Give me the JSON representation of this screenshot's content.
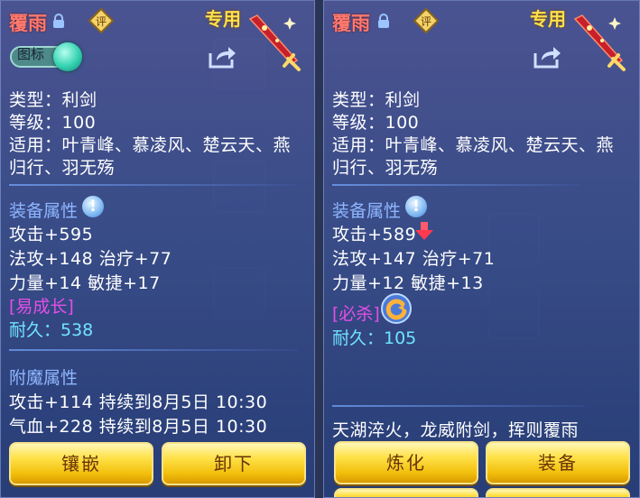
{
  "left": {
    "name": "覆雨",
    "exclusive": "专用",
    "toggle_label": "图标",
    "type": "类型：利剑",
    "level": "等级：100",
    "usable": "适用：叶青峰、慕凌风、楚云天、燕",
    "usable_cont": "归行、羽无殇",
    "attr_title": "装备属性",
    "attack": "攻击+595",
    "line2": "法攻+148  治疗+77",
    "line3": "力量+14  敏捷+17",
    "tag": "[易成长]",
    "durability": "耐久：538",
    "enchant_title": "附魔属性",
    "enchant1": "攻击+114  持续到8月5日 10:30",
    "enchant2": "气血+228  持续到8月5日 10:30",
    "btn1": "镶嵌",
    "btn2": "卸下"
  },
  "right": {
    "name": "覆雨",
    "exclusive": "专用",
    "type": "类型：利剑",
    "level": "等级：100",
    "usable": "适用：叶青峰、慕凌风、楚云天、燕",
    "usable_cont": "归行、羽无殇",
    "attr_title": "装备属性",
    "attack": "攻击+589",
    "line2": "法攻+147  治疗+71",
    "line3": "力量+12  敏捷+13",
    "tag": "[必杀]",
    "durability": "耐久：105",
    "flavor": "天湖淬火，龙威附剑，挥则覆雨",
    "btn1": "炼化",
    "btn2": "装备"
  },
  "icons": {
    "lock": "lock-icon",
    "rate": "rate-icon",
    "sword": "sword-icon",
    "share": "share-icon",
    "info": "info-icon",
    "arrow_down": "arrow-down-icon",
    "refine": "refine-icon"
  },
  "colors": {
    "name": "#ff7a6e",
    "exclusive": "#ffe04a",
    "section": "#8fb6ff",
    "tag": "#e24fe8",
    "durability": "#6fe4ff",
    "button": "#f2bf0c"
  }
}
